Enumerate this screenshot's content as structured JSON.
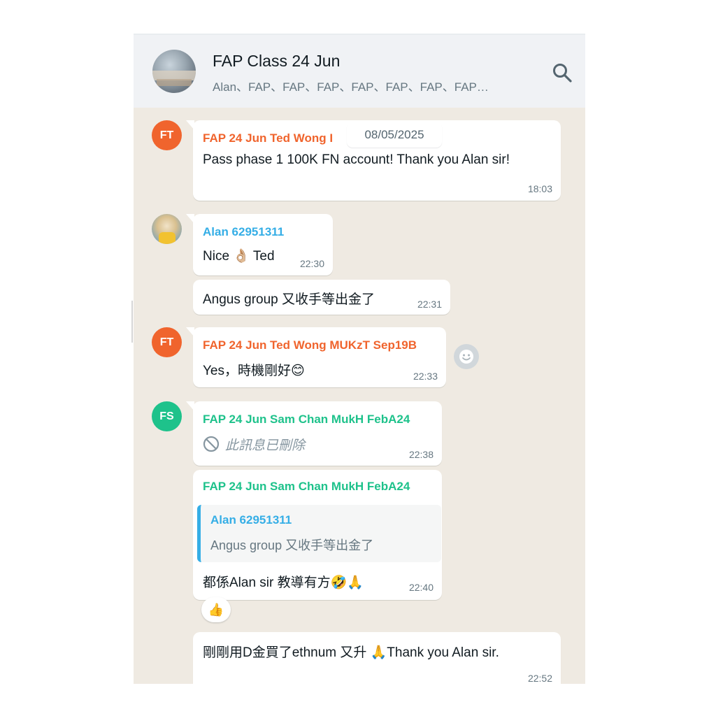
{
  "header": {
    "title": "FAP Class 24 Jun",
    "members": "Alan、FAP、FAP、FAP、FAP、FAP、FAP、FAP…",
    "search_icon": "search-icon"
  },
  "date_chip": "08/05/2025",
  "colors": {
    "ted": "#f0642d",
    "sam": "#1ec28b",
    "alan": "#35aee6",
    "chat_bg": "#efeae2",
    "header_bg": "#f0f2f5"
  },
  "avatars": {
    "ted_initials": "FT",
    "sam_initials": "FS"
  },
  "messages": [
    {
      "sender": "FAP 24 Jun Ted Wong MUKzT Sep19B",
      "sender_visible": "FAP 24 Jun Ted Wong I",
      "text": "Pass phase 1 100K FN account! Thank you Alan sir!",
      "time": "18:03"
    },
    {
      "sender": "Alan 62951311",
      "text": "Nice 👌🏼 Ted",
      "time": "22:30"
    },
    {
      "text": "Angus group 又收手等出金了",
      "time": "22:31"
    },
    {
      "sender": "FAP 24 Jun Ted Wong MUKzT Sep19B",
      "text": "Yes，時機剛好😊",
      "time": "22:33"
    },
    {
      "sender": "FAP 24 Jun Sam Chan MukH FebA24",
      "text": "此訊息已刪除",
      "time": "22:38"
    },
    {
      "sender": "FAP 24 Jun Sam Chan MukH FebA24",
      "quote_sender": "Alan 62951311",
      "quote_text": "Angus group 又收手等出金了",
      "text": "都係Alan sir 教導有方🤣🙏",
      "time": "22:40",
      "reaction": "👍"
    },
    {
      "text": "剛剛用D金買了ethnum 又升 🙏Thank you Alan sir.",
      "time": "22:52"
    }
  ]
}
